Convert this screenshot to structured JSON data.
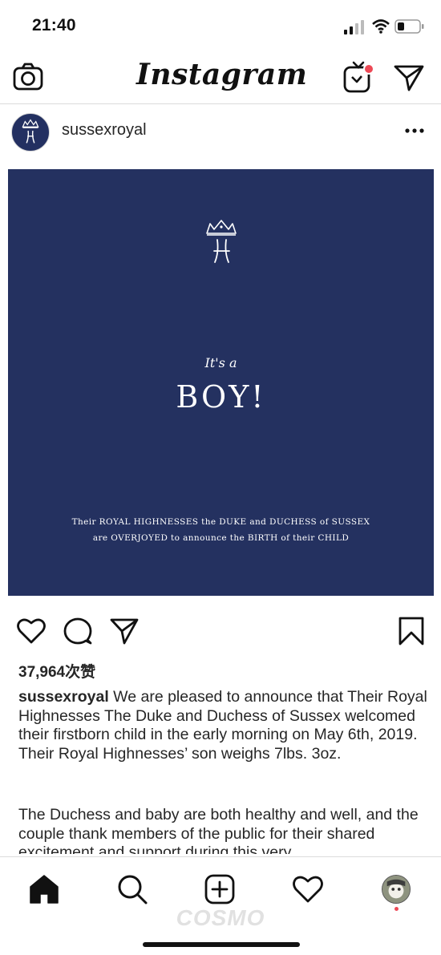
{
  "status_bar": {
    "time": "21:40"
  },
  "top_nav": {
    "logo": "Instagram",
    "icons": {
      "camera": "camera-icon",
      "igtv": "igtv-icon",
      "direct": "paper-plane-icon"
    },
    "igtv_badge_color": "#ed4956"
  },
  "post": {
    "username": "sussexroyal",
    "avatar_monogram": "H",
    "image": {
      "background_color": "#243160",
      "tagline": "It's a",
      "headline": "BOY!",
      "announcement_line1": "Their ROYAL HIGHNESSES the DUKE and DUCHESS of SUSSEX",
      "announcement_line2": "are OVERJOYED to announce the BIRTH of their CHILD"
    },
    "likes": "37,964次赞",
    "caption": {
      "username": "sussexroyal",
      "text": " We are pleased to announce that Their Royal Highnesses The Duke and Duchess of Sussex welcomed their firstborn child in the early morning on May 6th, 2019. Their Royal Highnesses’ son weighs 7lbs. 3oz.",
      "paragraph2": "The Duchess and baby are  both healthy and well, and the couple thank members of the public for their shared excitement and support during this very"
    }
  },
  "bottom_nav": {
    "tabs": [
      "home-icon",
      "search-icon",
      "add-post-icon",
      "heart-icon",
      "profile-avatar"
    ],
    "watermark": "COSMO"
  }
}
